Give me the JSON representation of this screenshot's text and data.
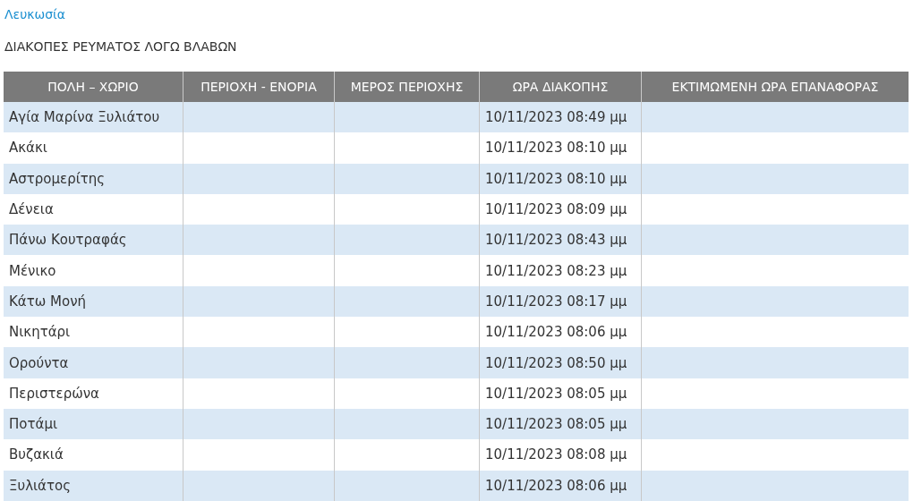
{
  "city_link": "Λευκωσία",
  "heading": "ΔΙΑΚΟΠΕΣ ΡΕΥΜΑΤΟΣ ΛΟΓΩ ΒΛΑΒΩΝ",
  "table": {
    "columns": [
      "ΠΟΛΗ – ΧΩΡΙΟ",
      "ΠΕΡΙΟΧΗ - ΕΝΟΡΙΑ",
      "ΜΕΡΟΣ ΠΕΡΙΟΧΗΣ",
      "ΩΡΑ ΔΙΑΚΟΠΗΣ",
      "ΕΚΤΙΜΩΜΕΝΗ ΩΡΑ ΕΠΑΝΑΦΟΡΑΣ"
    ],
    "rows": [
      {
        "village": "Αγία Μαρίνα Ξυλιάτου",
        "outage_time": "10/11/2023 08:49 μμ"
      },
      {
        "village": "Ακάκι",
        "outage_time": "10/11/2023 08:10 μμ"
      },
      {
        "village": "Αστρομερίτης",
        "outage_time": "10/11/2023 08:10 μμ"
      },
      {
        "village": "Δένεια",
        "outage_time": "10/11/2023 08:09 μμ"
      },
      {
        "village": "Πάνω Κουτραφάς",
        "outage_time": "10/11/2023 08:43 μμ"
      },
      {
        "village": "Μένικο",
        "outage_time": "10/11/2023 08:23 μμ"
      },
      {
        "village": "Κάτω Μονή",
        "outage_time": "10/11/2023 08:17 μμ"
      },
      {
        "village": "Νικητάρι",
        "outage_time": "10/11/2023 08:06 μμ"
      },
      {
        "village": "Ορούντα",
        "outage_time": "10/11/2023 08:50 μμ"
      },
      {
        "village": "Περιστερώνα",
        "outage_time": "10/11/2023 08:05 μμ"
      },
      {
        "village": "Ποτάμι",
        "outage_time": "10/11/2023 08:05 μμ"
      },
      {
        "village": "Βυζακιά",
        "outage_time": "10/11/2023 08:08 μμ"
      },
      {
        "village": "Ξυλιάτος",
        "outage_time": "10/11/2023 08:06 μμ"
      }
    ]
  }
}
